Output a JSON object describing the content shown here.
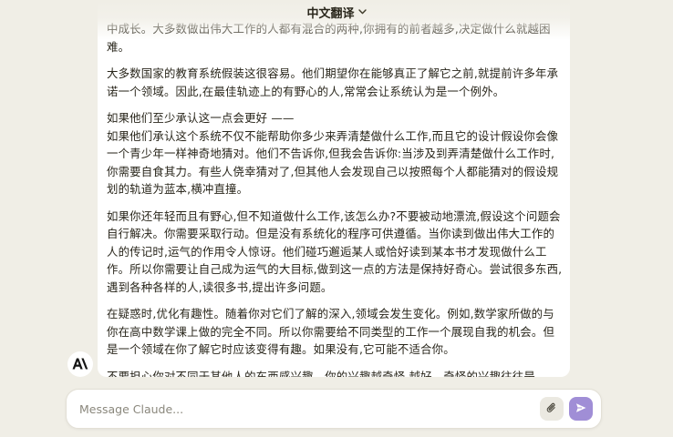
{
  "header": {
    "title": "中文翻译",
    "chevron_icon": "chevron-down-icon"
  },
  "message": {
    "paragraphs": [
      "中成长。大多数做出伟大工作的人都有混合的两种,你拥有的前者越多,决定做什么就越困难。",
      "大多数国家的教育系统假装这很容易。他们期望你在能够真正了解它之前,就提前许多年承诺一个领域。因此,在最佳轨迹上的有野心的人,常常会让系统认为是一个例外。",
      "如果他们至少承认这一点会更好 ——",
      "如果他们承认这个系统不仅不能帮助你多少来弄清楚做什么工作,而且它的设计假设你会像一个青少年一样神奇地猜对。他们不告诉你,但我会告诉你:当涉及到弄清楚做什么工作时,你需要自食其力。有些人侥幸猜对了,但其他人会发现自己以按照每个人都能猜对的假设规划的轨道为蓝本,横冲直撞。",
      "如果你还年轻而且有野心,但不知道做什么工作,该怎么办?不要被动地漂流,假设这个问题会自行解决。你需要采取行动。但是没有系统化的程序可供遵循。当你读到做出伟大工作的人的传记时,运气的作用令人惊讶。他们碰巧邂逅某人或恰好读到某本书才发现做什么工作。所以你需要让自己成为运气的大目标,做到这一点的方法是保持好奇心。尝试很多东西,遇到各种各样的人,读很多书,提出许多问题。",
      "在疑惑时,优化有趣性。随着你对它们了解的深入,领域会发生变化。例如,数学家所做的与你在高中数学课上做的完全不同。所以你需要给不同类型的工作一个展现自我的机会。但是一个领域在你了解它时应该变得有趣。如果没有,它可能不适合你。",
      "不要担心你对不同于其他人的东西感兴趣。你的兴趣越奇怪,越好。奇怪的兴趣往往是"
    ]
  },
  "composer": {
    "placeholder": "Message Claude...",
    "attach_icon": "paperclip-icon",
    "send_icon": "send-arrow-icon"
  },
  "assistant": {
    "avatar_icon": "anthropic-logo-icon"
  },
  "colors": {
    "background": "#f0eee6",
    "bubble": "#ffffff",
    "send_button": "#a08ed6",
    "text": "#29261b"
  }
}
